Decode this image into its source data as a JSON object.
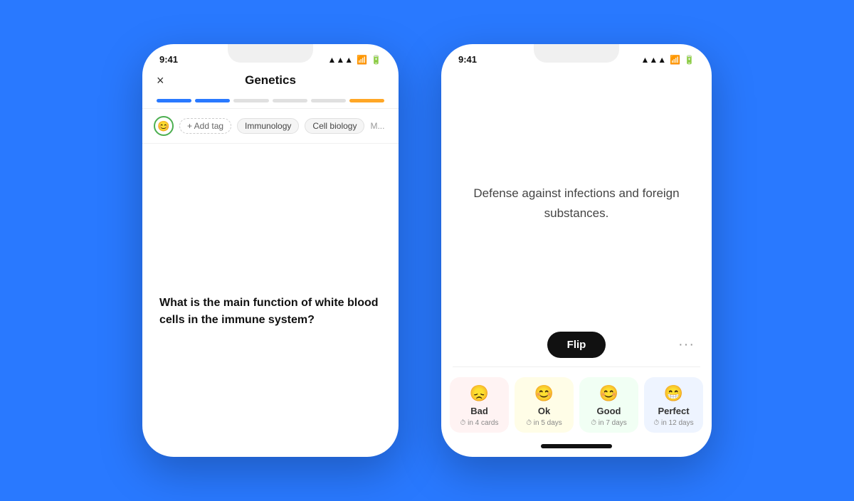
{
  "background_color": "#2979FF",
  "phone1": {
    "status_time": "9:41",
    "title": "Genetics",
    "close_label": "×",
    "progress_segments": [
      {
        "type": "blue",
        "filled": true
      },
      {
        "type": "blue",
        "filled": true
      },
      {
        "type": "gray",
        "filled": false
      },
      {
        "type": "gray",
        "filled": false
      },
      {
        "type": "gray",
        "filled": false
      },
      {
        "type": "orange",
        "filled": true
      }
    ],
    "add_tag_label": "+ Add tag",
    "tags": [
      "Immunology",
      "Cell biology",
      "M..."
    ],
    "question": "What is the main function of white blood cells in the immune system?"
  },
  "phone2": {
    "status_time": "9:41",
    "answer": "Defense against infections and foreign substances.",
    "flip_button": "Flip",
    "more_button": "···",
    "ratings": [
      {
        "id": "bad",
        "emoji": "😞",
        "label": "Bad",
        "sub": "in 4 cards",
        "css_class": "bad"
      },
      {
        "id": "ok",
        "emoji": "😊",
        "label": "Ok",
        "sub": "in 5 days",
        "css_class": "ok"
      },
      {
        "id": "good",
        "emoji": "😊",
        "label": "Good",
        "sub": "in 7 days",
        "css_class": "good"
      },
      {
        "id": "perfect",
        "emoji": "😁",
        "label": "Perfect",
        "sub": "in 12 days",
        "css_class": "perfect"
      }
    ]
  }
}
